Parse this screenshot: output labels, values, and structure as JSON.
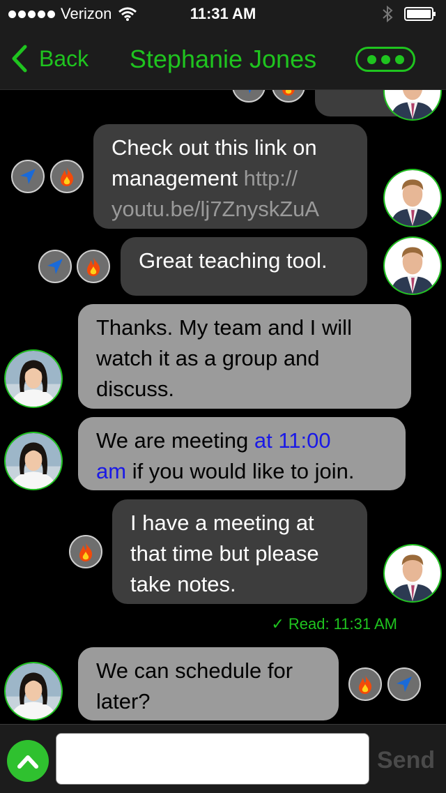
{
  "status_bar": {
    "carrier": "Verizon",
    "time": "11:31 AM",
    "signal_bars": 5
  },
  "nav": {
    "back_label": "Back",
    "title": "Stephanie Jones",
    "accent_color": "#1fc41f"
  },
  "messages": [
    {
      "sender": "me",
      "text": "Check out this link on management",
      "link": "http://youtu.be/lj7ZnyskZuA",
      "link_line1": "http://",
      "link_line2": "youtu.be/lj7ZnyskZuA",
      "icons": [
        "location-arrow-icon",
        "fire-icon"
      ]
    },
    {
      "sender": "me",
      "text": "Great teaching tool.",
      "icons": [
        "location-arrow-icon",
        "fire-icon"
      ]
    },
    {
      "sender": "them",
      "text_lines": [
        "Thanks.  My team and I will",
        "watch it as a group and",
        "discuss."
      ]
    },
    {
      "sender": "them",
      "text_lines": [
        "We are meeting ",
        "at 11:00",
        "am",
        " if you would like to join."
      ]
    },
    {
      "sender": "me",
      "text_lines": [
        "I have a meeting at",
        "that time but please",
        "take notes."
      ],
      "icons": [
        "fire-icon"
      ]
    },
    {
      "sender": "them",
      "text_lines": [
        "We can schedule for",
        "later?"
      ],
      "icons": [
        "fire-icon",
        "location-arrow-icon"
      ]
    }
  ],
  "read_receipt": "✓ Read: 11:31 AM",
  "composer": {
    "input_value": "",
    "send_label": "Send"
  }
}
